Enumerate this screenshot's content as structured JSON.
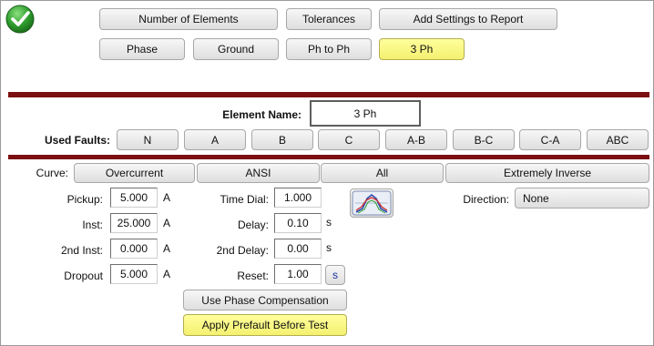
{
  "top_tabs": {
    "number_of_elements": "Number of Elements",
    "tolerances": "Tolerances",
    "add_settings": "Add Settings to Report",
    "phase": "Phase",
    "ground": "Ground",
    "ph_to_ph": "Ph to Ph",
    "three_ph": "3 Ph"
  },
  "element": {
    "label": "Element Name:",
    "value": "3 Ph"
  },
  "faults": {
    "label": "Used Faults:",
    "items": [
      "N",
      "A",
      "B",
      "C",
      "A-B",
      "B-C",
      "C-A",
      "ABC"
    ]
  },
  "curve": {
    "label": "Curve:",
    "type": "Overcurrent",
    "standard": "ANSI",
    "filter": "All",
    "shape": "Extremely Inverse"
  },
  "settings": {
    "pickup": {
      "label": "Pickup:",
      "value": "5.000",
      "unit": "A"
    },
    "inst": {
      "label": "Inst:",
      "value": "25.000",
      "unit": "A"
    },
    "inst2": {
      "label": "2nd Inst:",
      "value": "0.000",
      "unit": "A"
    },
    "dropout": {
      "label": "Dropout",
      "value": "5.000",
      "unit": "A"
    },
    "time_dial": {
      "label": "Time Dial:",
      "value": "1.000"
    },
    "delay": {
      "label": "Delay:",
      "value": "0.10",
      "unit": "s"
    },
    "delay2": {
      "label": "2nd Delay:",
      "value": "0.00",
      "unit": "s"
    },
    "reset": {
      "label": "Reset:",
      "value": "1.00",
      "unit": "s"
    },
    "direction": {
      "label": "Direction:",
      "value": "None"
    }
  },
  "actions": {
    "phase_compensation": "Use Phase Compensation",
    "apply_prefault": "Apply Prefault Before Test"
  },
  "colors": {
    "accent_bar": "#7b0f12",
    "active_button": "#ffff9c",
    "check_green": "#2e9e2e"
  },
  "icons": {
    "status": "checkmark-icon",
    "curve": "curve-graph-icon"
  }
}
